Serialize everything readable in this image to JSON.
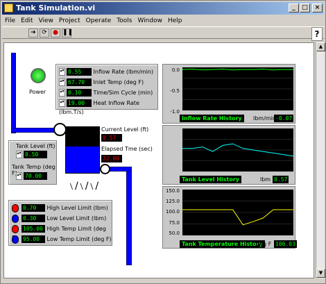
{
  "window": {
    "title": "Tank Simulation.vi"
  },
  "menu": [
    "File",
    "Edit",
    "View",
    "Project",
    "Operate",
    "Tools",
    "Window",
    "Help"
  ],
  "power": {
    "label": "Power",
    "on": true
  },
  "inputs": [
    {
      "value": "0.55",
      "label": "Inflow Rate (lbm/min)"
    },
    {
      "value": "67.70",
      "label": "Inlet Temp (deg F)"
    },
    {
      "value": "0.10",
      "label": "Time/Sim Cycle (min)"
    },
    {
      "value": "19.00",
      "label": "Heat Inflow Rate (lbm.T/s)"
    }
  ],
  "tank": {
    "level_label": "Tank Level (ft)",
    "level_value": "0.50",
    "temp_label": "Tank Temp (deg F)",
    "temp_value": "70.00"
  },
  "status": {
    "current_level_label": "Current Level (ft)",
    "current_level_value": "0.57",
    "elapsed_label": "Elapsed Tme (sec)",
    "elapsed_value": "22.80"
  },
  "limits": [
    {
      "value": "0.70",
      "label": "High Level Limit (lbm)",
      "color": "#ff0000"
    },
    {
      "value": "0.30",
      "label": "Low Level Limit (lbm)",
      "color": "#0000ff"
    },
    {
      "value": "105.00",
      "label": "High Temp Limit (deg F)",
      "color": "#ff0000"
    },
    {
      "value": "95.00",
      "label": "Low Temp Limit (deg F)",
      "color": "#0000ff"
    }
  ],
  "charts": {
    "inflow": {
      "title": "Inflow Rate History",
      "unit": "lbm/min",
      "value": "-0.07",
      "yticks": [
        "0.0",
        "-0.5",
        "-1.0"
      ]
    },
    "level": {
      "title": "Tank Level History",
      "unit": "lbm",
      "value": "0.57"
    },
    "temp": {
      "title": "Tank Temperature History",
      "unit": "deg F",
      "value": "106.03",
      "yticks": [
        "150.0",
        "125.0",
        "100.0",
        "75.0",
        "50.0"
      ]
    }
  },
  "chart_data": [
    {
      "type": "line",
      "title": "Inflow Rate History",
      "ylim": [
        -1.0,
        0.0
      ],
      "series": [
        {
          "values": [
            -0.05,
            -0.04,
            -0.06,
            -0.05,
            -0.04,
            -0.06,
            -0.05,
            -0.05,
            -0.04,
            -0.06,
            -0.05,
            -0.05
          ]
        }
      ]
    },
    {
      "type": "line",
      "title": "Tank Level History",
      "series": [
        {
          "values": [
            0.62,
            0.62,
            0.63,
            0.6,
            0.64,
            0.65,
            0.62,
            0.61,
            0.6,
            0.59,
            0.58,
            0.57
          ]
        }
      ]
    },
    {
      "type": "line",
      "title": "Tank Temperature History",
      "ylim": [
        50,
        150
      ],
      "series": [
        {
          "values": [
            106,
            106,
            106,
            106,
            106,
            106,
            73,
            80,
            88,
            106,
            106,
            106
          ]
        }
      ]
    }
  ]
}
